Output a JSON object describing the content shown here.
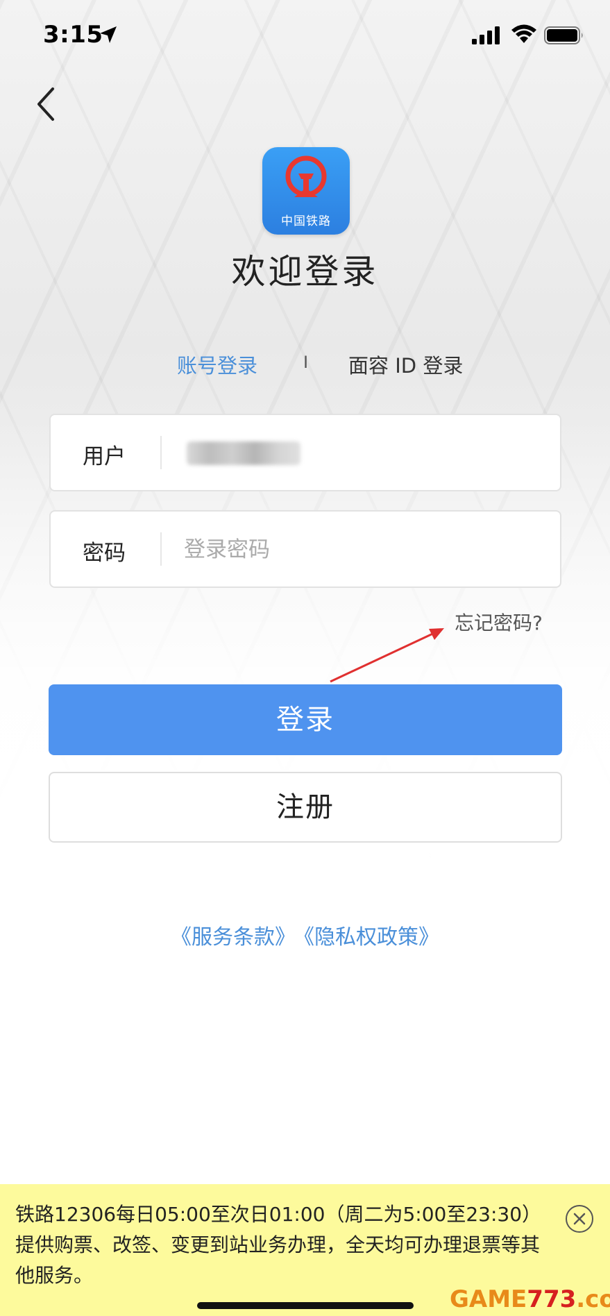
{
  "status_bar": {
    "time": "3:15"
  },
  "logo": {
    "text": "中国铁路"
  },
  "title": "欢迎登录",
  "tabs": {
    "account": "账号登录",
    "separator": "I",
    "face_id": "面容 ID 登录"
  },
  "form": {
    "username_label": "用户",
    "password_label": "密码",
    "password_placeholder": "登录密码",
    "forgot": "忘记密码?"
  },
  "buttons": {
    "login": "登录",
    "register": "注册"
  },
  "links": {
    "terms": "《服务条款》",
    "privacy": "《隐私权政策》"
  },
  "notice": {
    "text": "铁路12306每日05:00至次日01:00（周二为5:00至23:30）提供购票、改签、变更到站业务办理，全天均可办理退票等其他服务。"
  },
  "watermark": {
    "part1": "GAME",
    "part2": "773",
    "part3": ".com"
  },
  "colors": {
    "accent": "#4f93ef",
    "link": "#4a8fd9",
    "notice_bg": "#fdfa9c",
    "arrow": "#e03030"
  }
}
